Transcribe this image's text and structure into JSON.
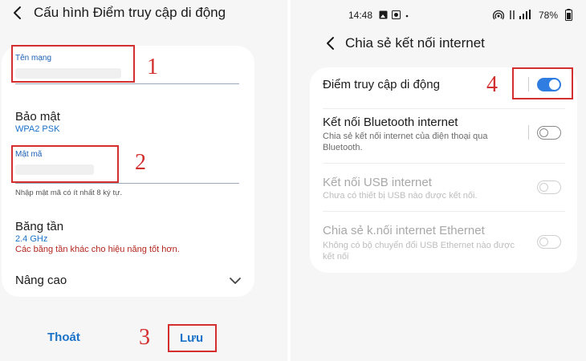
{
  "left": {
    "header_title": "Cấu hình Điểm truy cập di động",
    "network_name": {
      "label": "Tên mạng"
    },
    "security": {
      "title": "Bảo mật",
      "value": "WPA2 PSK"
    },
    "password": {
      "label": "Mật mã",
      "hint": "Nhập mật mã có ít nhất 8 ký tự."
    },
    "band": {
      "title": "Băng tần",
      "value": "2.4 GHz",
      "warning": "Các băng tần khác cho hiệu năng tốt hơn."
    },
    "advanced": {
      "title": "Nâng cao"
    },
    "buttons": {
      "exit": "Thoát",
      "save": "Lưu"
    }
  },
  "right": {
    "status_bar": {
      "time": "14:48",
      "battery": "78%"
    },
    "header_title": "Chia sẻ kết nối internet",
    "settings": [
      {
        "title": "Điểm truy cập di động",
        "subtitle": "",
        "state": "on",
        "enabled": true
      },
      {
        "title": "Kết nối Bluetooth internet",
        "subtitle": "Chia sẻ kết nối internet của điện thoại qua Bluetooth.",
        "state": "off",
        "enabled": true
      },
      {
        "title": "Kết nối USB internet",
        "subtitle": "Chưa có thiết bị USB nào được kết nối.",
        "state": "off",
        "enabled": false
      },
      {
        "title": "Chia sẻ k.nối internet Ethernet",
        "subtitle": "Không có bộ chuyển đổi USB Ethernet nào được kết nối",
        "state": "off",
        "enabled": false
      }
    ]
  },
  "annotations": {
    "step1": "1",
    "step2": "2",
    "step3": "3",
    "step4": "4"
  },
  "colors": {
    "accent": "#1a72c9",
    "toggle_on": "#2f7de1",
    "annotation_red": "#d32f2f",
    "warning": "#b3261e"
  }
}
